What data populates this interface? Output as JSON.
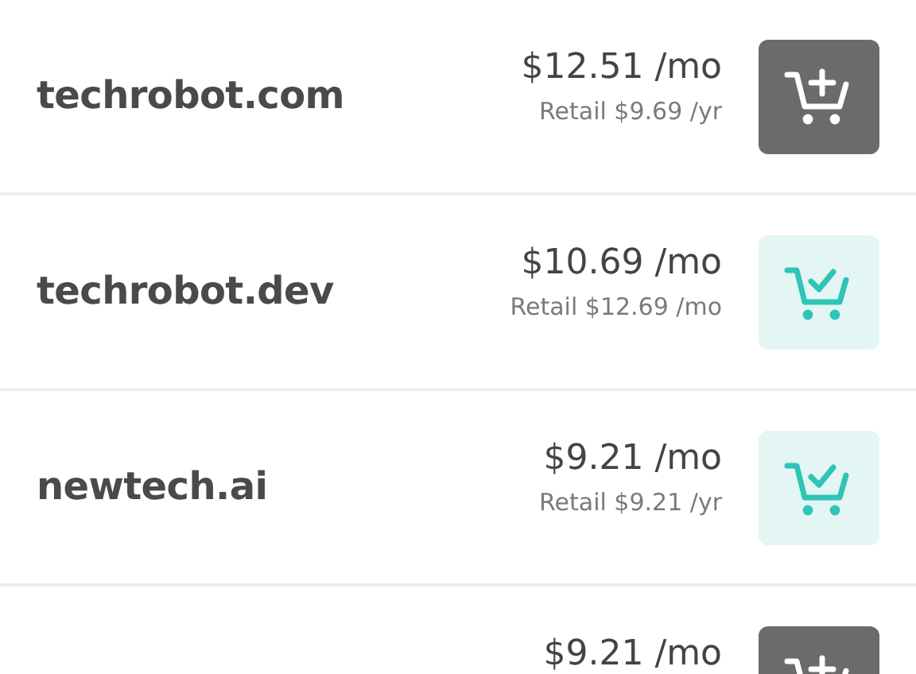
{
  "domains": [
    {
      "name": "techrobot.com",
      "price": "$12.51 /mo",
      "retail": "Retail $9.69 /yr",
      "in_cart": false
    },
    {
      "name": "techrobot.dev",
      "price": "$10.69 /mo",
      "retail": "Retail $12.69 /mo",
      "in_cart": true
    },
    {
      "name": "newtech.ai",
      "price": "$9.21 /mo",
      "retail": "Retail $9.21 /yr",
      "in_cart": true
    },
    {
      "price": "$9.21 /mo",
      "in_cart": false
    }
  ]
}
